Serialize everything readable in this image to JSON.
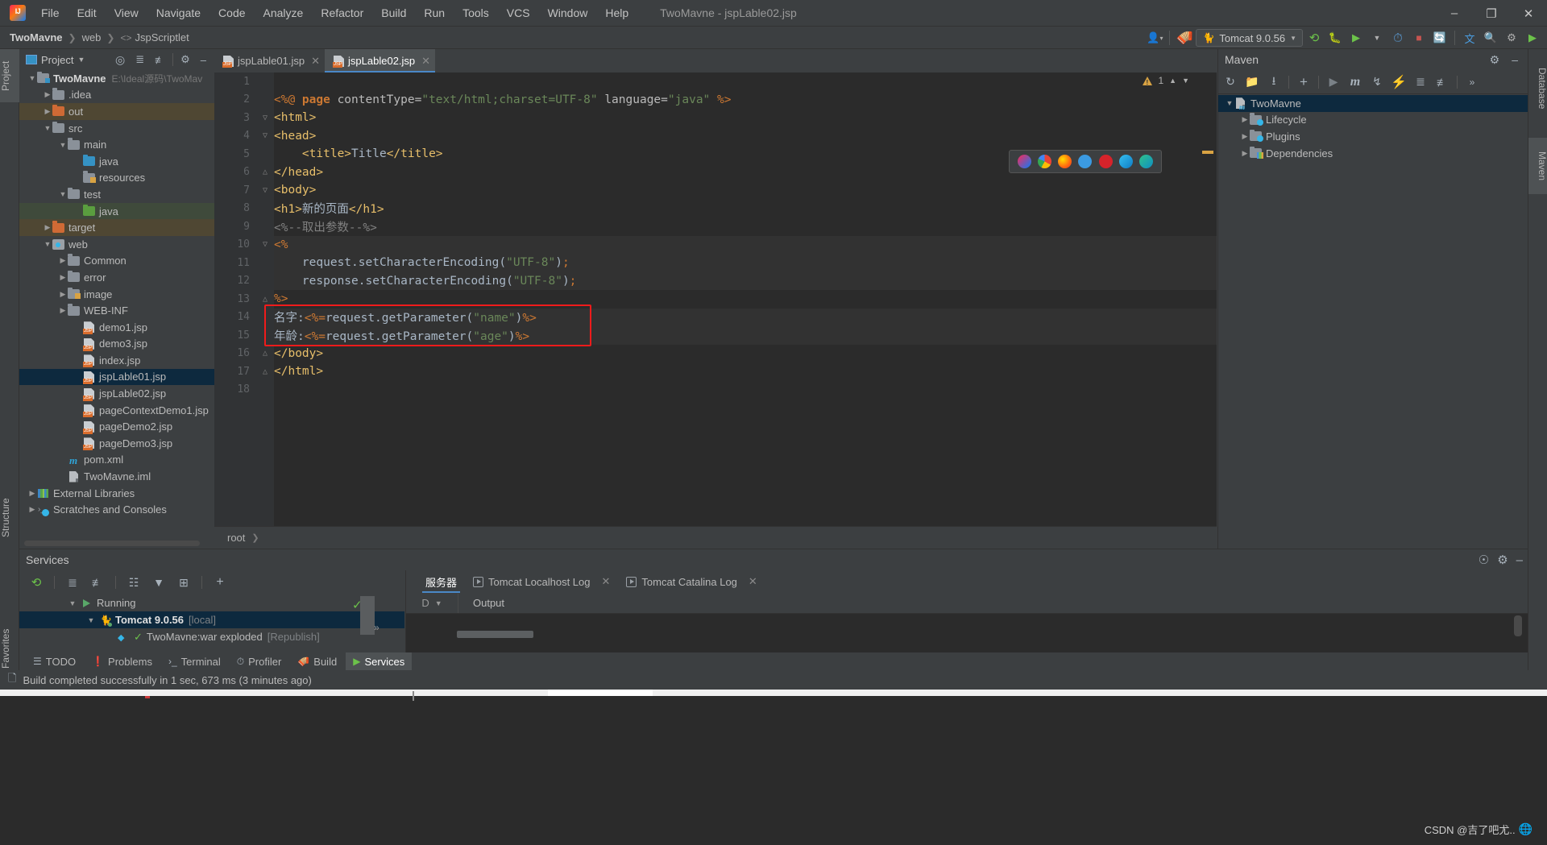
{
  "window": {
    "title": "TwoMavne - jspLable02.jsp",
    "minimize": "–",
    "maximize": "❐",
    "close": "✕"
  },
  "menubar": {
    "logo": "intellij-logo",
    "items": [
      "File",
      "Edit",
      "View",
      "Navigate",
      "Code",
      "Analyze",
      "Refactor",
      "Build",
      "Run",
      "Tools",
      "VCS",
      "Window",
      "Help"
    ]
  },
  "navbar": {
    "breadcrumb": [
      "TwoMavne",
      "web",
      "JspScriptlet"
    ],
    "run_config": "Tomcat 9.0.56",
    "icons": [
      "user-icon",
      "hammer-icon",
      "rerun-icon",
      "debug-icon",
      "run-with-coverage-icon",
      "profiler-icon",
      "stop-icon",
      "search-everywhere-icon",
      "translate-icon",
      "settings-icon",
      "updates-icon"
    ]
  },
  "left_stripe": {
    "tabs": [
      "Project",
      "Structure",
      "Favorites"
    ]
  },
  "right_stripe": {
    "tabs": [
      "Database",
      "Maven"
    ]
  },
  "project_panel": {
    "title": "Project",
    "header_icons": [
      "locate-icon",
      "expand-all-icon",
      "collapse-all-icon",
      "gear-icon",
      "hide-icon"
    ],
    "tree": [
      {
        "label": "TwoMavne",
        "path": "E:\\Ideal源码\\TwoMav",
        "depth": 0,
        "arrow": "expanded",
        "icon": "module-folder-icon",
        "bold": true,
        "state": "normal"
      },
      {
        "label": ".idea",
        "path": "",
        "depth": 1,
        "arrow": "collapsed",
        "icon": "folder-grey-icon",
        "bold": false,
        "state": "normal"
      },
      {
        "label": "out",
        "path": "",
        "depth": 1,
        "arrow": "collapsed",
        "icon": "folder-orange-icon",
        "bold": false,
        "state": "excluded"
      },
      {
        "label": "src",
        "path": "",
        "depth": 1,
        "arrow": "expanded",
        "icon": "folder-grey-icon",
        "bold": false,
        "state": "normal"
      },
      {
        "label": "main",
        "path": "",
        "depth": 2,
        "arrow": "expanded",
        "icon": "folder-grey-icon",
        "bold": false,
        "state": "normal"
      },
      {
        "label": "java",
        "path": "",
        "depth": 3,
        "arrow": "none",
        "icon": "folder-source-blue-icon",
        "bold": false,
        "state": "normal"
      },
      {
        "label": "resources",
        "path": "",
        "depth": 3,
        "arrow": "none",
        "icon": "folder-resources-icon",
        "bold": false,
        "state": "normal"
      },
      {
        "label": "test",
        "path": "",
        "depth": 2,
        "arrow": "expanded",
        "icon": "folder-grey-icon",
        "bold": false,
        "state": "normal"
      },
      {
        "label": "java",
        "path": "",
        "depth": 3,
        "arrow": "none",
        "icon": "folder-test-green-icon",
        "bold": false,
        "state": "test-source"
      },
      {
        "label": "target",
        "path": "",
        "depth": 1,
        "arrow": "collapsed",
        "icon": "folder-orange-icon",
        "bold": false,
        "state": "excluded"
      },
      {
        "label": "web",
        "path": "",
        "depth": 1,
        "arrow": "expanded",
        "icon": "folder-web-icon",
        "bold": false,
        "state": "normal"
      },
      {
        "label": "Common",
        "path": "",
        "depth": 2,
        "arrow": "collapsed",
        "icon": "folder-grey-icon",
        "bold": false,
        "state": "normal"
      },
      {
        "label": "error",
        "path": "",
        "depth": 2,
        "arrow": "collapsed",
        "icon": "folder-grey-icon",
        "bold": false,
        "state": "normal"
      },
      {
        "label": "image",
        "path": "",
        "depth": 2,
        "arrow": "collapsed",
        "icon": "folder-resources-icon",
        "bold": false,
        "state": "normal"
      },
      {
        "label": "WEB-INF",
        "path": "",
        "depth": 2,
        "arrow": "collapsed",
        "icon": "folder-grey-icon",
        "bold": false,
        "state": "normal"
      },
      {
        "label": "demo1.jsp",
        "path": "",
        "depth": 3,
        "arrow": "none",
        "icon": "jsp-file-icon",
        "bold": false,
        "state": "normal"
      },
      {
        "label": "demo3.jsp",
        "path": "",
        "depth": 3,
        "arrow": "none",
        "icon": "jsp-file-icon",
        "bold": false,
        "state": "normal"
      },
      {
        "label": "index.jsp",
        "path": "",
        "depth": 3,
        "arrow": "none",
        "icon": "jsp-file-icon",
        "bold": false,
        "state": "normal"
      },
      {
        "label": "jspLable01.jsp",
        "path": "",
        "depth": 3,
        "arrow": "none",
        "icon": "jsp-file-icon",
        "bold": false,
        "state": "selected"
      },
      {
        "label": "jspLable02.jsp",
        "path": "",
        "depth": 3,
        "arrow": "none",
        "icon": "jsp-file-icon",
        "bold": false,
        "state": "normal"
      },
      {
        "label": "pageContextDemo1.jsp",
        "path": "",
        "depth": 3,
        "arrow": "none",
        "icon": "jsp-file-icon",
        "bold": false,
        "state": "normal"
      },
      {
        "label": "pageDemo2.jsp",
        "path": "",
        "depth": 3,
        "arrow": "none",
        "icon": "jsp-file-icon",
        "bold": false,
        "state": "normal"
      },
      {
        "label": "pageDemo3.jsp",
        "path": "",
        "depth": 3,
        "arrow": "none",
        "icon": "jsp-file-icon",
        "bold": false,
        "state": "normal"
      },
      {
        "label": "pom.xml",
        "path": "",
        "depth": 2,
        "arrow": "none",
        "icon": "maven-pom-icon",
        "bold": false,
        "state": "normal"
      },
      {
        "label": "TwoMavne.iml",
        "path": "",
        "depth": 2,
        "arrow": "none",
        "icon": "iml-file-icon",
        "bold": false,
        "state": "normal"
      },
      {
        "label": "External Libraries",
        "path": "",
        "depth": 0,
        "arrow": "collapsed",
        "icon": "external-libraries-icon",
        "bold": false,
        "state": "normal"
      },
      {
        "label": "Scratches and Consoles",
        "path": "",
        "depth": 0,
        "arrow": "collapsed",
        "icon": "scratches-icon",
        "bold": false,
        "state": "normal"
      }
    ]
  },
  "editor": {
    "tabs": [
      {
        "label": "jspLable01.jsp",
        "active": false
      },
      {
        "label": "jspLable02.jsp",
        "active": true
      }
    ],
    "warning_count": "1",
    "breadcrumb": "root",
    "browser_popup": [
      "intellij-preview-icon",
      "chrome-icon",
      "firefox-icon",
      "safari-icon",
      "opera-icon",
      "edge-icon",
      "edge-chromium-icon"
    ],
    "lines": [
      {
        "n": "1",
        "fold": "",
        "segments": []
      },
      {
        "n": "2",
        "fold": "",
        "segments": [
          {
            "t": "<%@ ",
            "c": "kw"
          },
          {
            "t": "page ",
            "c": "kw-b"
          },
          {
            "t": "contentType=",
            "c": "attr"
          },
          {
            "t": "\"text/html;charset=UTF-8\"",
            "c": "str"
          },
          {
            "t": " language=",
            "c": "attr"
          },
          {
            "t": "\"java\"",
            "c": "str"
          },
          {
            "t": " %>",
            "c": "kw"
          }
        ]
      },
      {
        "n": "3",
        "fold": "open",
        "segments": [
          {
            "t": "<html>",
            "c": "tag"
          }
        ]
      },
      {
        "n": "4",
        "fold": "open",
        "segments": [
          {
            "t": "<head>",
            "c": "tag"
          }
        ]
      },
      {
        "n": "5",
        "fold": "",
        "segments": [
          {
            "t": "    <title>",
            "c": "tag"
          },
          {
            "t": "Title",
            "c": "plain"
          },
          {
            "t": "</title>",
            "c": "tag"
          }
        ]
      },
      {
        "n": "6",
        "fold": "close",
        "segments": [
          {
            "t": "</head>",
            "c": "tag"
          }
        ]
      },
      {
        "n": "7",
        "fold": "open",
        "segments": [
          {
            "t": "<body>",
            "c": "tag"
          }
        ]
      },
      {
        "n": "8",
        "fold": "",
        "segments": [
          {
            "t": "<h1>",
            "c": "tag"
          },
          {
            "t": "新的页面",
            "c": "plain"
          },
          {
            "t": "</h1>",
            "c": "tag"
          }
        ]
      },
      {
        "n": "9",
        "fold": "",
        "segments": [
          {
            "t": "<%--取出参数--%>",
            "c": "cmt"
          }
        ]
      },
      {
        "n": "10",
        "fold": "open",
        "segments": [
          {
            "t": "<%",
            "c": "kw"
          }
        ]
      },
      {
        "n": "11",
        "fold": "",
        "segments": [
          {
            "t": "    request",
            "c": "plain"
          },
          {
            "t": ".setCharacterEncoding(",
            "c": "plain"
          },
          {
            "t": "\"UTF-8\"",
            "c": "str"
          },
          {
            "t": ")",
            "c": "plain"
          },
          {
            "t": ";",
            "c": "kw"
          }
        ]
      },
      {
        "n": "12",
        "fold": "",
        "segments": [
          {
            "t": "    response",
            "c": "plain"
          },
          {
            "t": ".setCharacterEncoding(",
            "c": "plain"
          },
          {
            "t": "\"UTF-8\"",
            "c": "str"
          },
          {
            "t": ")",
            "c": "plain"
          },
          {
            "t": ";",
            "c": "kw"
          }
        ]
      },
      {
        "n": "13",
        "fold": "close",
        "segments": [
          {
            "t": "%>",
            "c": "kw"
          }
        ]
      },
      {
        "n": "14",
        "fold": "",
        "segments": [
          {
            "t": "名字:",
            "c": "txtw"
          },
          {
            "t": "<%=",
            "c": "kw"
          },
          {
            "t": "request",
            "c": "plain"
          },
          {
            "t": ".getParameter(",
            "c": "plain"
          },
          {
            "t": "\"name\"",
            "c": "str"
          },
          {
            "t": ")",
            "c": "plain"
          },
          {
            "t": "%>",
            "c": "kw"
          }
        ]
      },
      {
        "n": "15",
        "fold": "",
        "segments": [
          {
            "t": "年龄:",
            "c": "txtw"
          },
          {
            "t": "<%=",
            "c": "kw"
          },
          {
            "t": "request",
            "c": "plain"
          },
          {
            "t": ".getParameter(",
            "c": "plain"
          },
          {
            "t": "\"age\"",
            "c": "str"
          },
          {
            "t": ")",
            "c": "plain"
          },
          {
            "t": "%>",
            "c": "kw"
          }
        ]
      },
      {
        "n": "16",
        "fold": "close",
        "segments": [
          {
            "t": "</body>",
            "c": "tag"
          }
        ]
      },
      {
        "n": "17",
        "fold": "close",
        "segments": [
          {
            "t": "</html>",
            "c": "tag"
          }
        ]
      },
      {
        "n": "18",
        "fold": "",
        "segments": []
      }
    ]
  },
  "maven_panel": {
    "title": "Maven",
    "toolbar_icons": [
      "reload-icon",
      "generate-sources-icon",
      "download-sources-icon",
      "add-icon",
      "run-icon",
      "maven-m-icon",
      "toggle-skip-tests-icon",
      "execute-goal-icon",
      "expand-all-icon",
      "collapse-all-icon",
      "more-icon"
    ],
    "header_icons": [
      "gear-icon",
      "hide-icon"
    ],
    "tree": [
      {
        "label": "TwoMavne",
        "depth": 0,
        "arrow": "expanded",
        "icon": "maven-project-icon",
        "state": "selected"
      },
      {
        "label": "Lifecycle",
        "depth": 1,
        "arrow": "collapsed",
        "icon": "lifecycle-folder-icon",
        "state": "normal"
      },
      {
        "label": "Plugins",
        "depth": 1,
        "arrow": "collapsed",
        "icon": "plugins-folder-icon",
        "state": "normal"
      },
      {
        "label": "Dependencies",
        "depth": 1,
        "arrow": "collapsed",
        "icon": "dependencies-folder-icon",
        "state": "normal"
      }
    ]
  },
  "services": {
    "title": "Services",
    "header_icons": [
      "help-icon",
      "gear-icon",
      "hide-icon"
    ],
    "toolbar_icons": [
      "rerun-icon",
      "expand-all-icon",
      "collapse-all-icon",
      "group-icon",
      "filter-icon",
      "add-frame-icon",
      "add-icon"
    ],
    "tree": [
      {
        "label": "Running",
        "suffix": "",
        "depth": 0,
        "arrow": "expanded",
        "icon": "run-green-icon",
        "state": "normal"
      },
      {
        "label": "Tomcat 9.0.56",
        "suffix": "[local]",
        "depth": 1,
        "arrow": "expanded",
        "icon": "tomcat-icon",
        "state": "selected"
      },
      {
        "label": "TwoMavne:war exploded",
        "suffix": "[Republish]",
        "depth": 2,
        "arrow": "none",
        "icon": "artifact-icon",
        "state": "normal"
      }
    ],
    "tabs": [
      {
        "label": "服务器",
        "icon": "",
        "closeable": false,
        "active": true
      },
      {
        "label": "Tomcat Localhost Log",
        "icon": "run-icon",
        "closeable": true,
        "active": false
      },
      {
        "label": "Tomcat Catalina Log",
        "icon": "run-icon",
        "closeable": true,
        "active": false
      }
    ],
    "output_label": "Output",
    "deploy_dropdown": "D"
  },
  "bottom_tabs": [
    {
      "label": "TODO",
      "icon": "todo-icon",
      "active": false
    },
    {
      "label": "Problems",
      "icon": "problems-icon",
      "active": false
    },
    {
      "label": "Terminal",
      "icon": "terminal-icon",
      "active": false
    },
    {
      "label": "Profiler",
      "icon": "profiler-icon",
      "active": false
    },
    {
      "label": "Build",
      "icon": "build-icon",
      "active": false
    },
    {
      "label": "Services",
      "icon": "services-icon",
      "active": true
    }
  ],
  "statusbar": {
    "icon": "build-status-icon",
    "message": "Build completed successfully in 1 sec, 673 ms (3 minutes ago)"
  },
  "watermark": "CSDN @吉了吧尤..",
  "colors": {
    "accent_blue": "#4a88c7",
    "selection_blue": "#0d293e",
    "panel_bg": "#3c3f41",
    "editor_bg": "#2b2b2b",
    "red_highlight": "#f01b1b",
    "orange_keyword": "#cc7832",
    "string_green": "#6a8759",
    "tag_yellow": "#e8bf6a"
  }
}
